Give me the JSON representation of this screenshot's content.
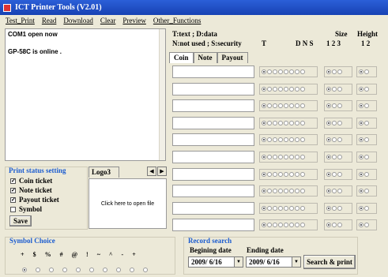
{
  "window": {
    "title": "ICT Printer Tools (V2.01)"
  },
  "menu": [
    "Test_Print",
    "Read",
    "Download",
    "Clear",
    "Preview",
    "Other_Functions"
  ],
  "log": {
    "lines": [
      "COM1  open now",
      "GP-58C is online ."
    ]
  },
  "legend": {
    "line1": "T:text ; D:data",
    "line2": "N:not used ; S:security",
    "col_T": "T",
    "col_DNS": "D N S",
    "size_label": "Size",
    "size_cols": "1  2  3",
    "height_label": "Height",
    "height_cols": "1   2"
  },
  "tabs": [
    "Coin",
    "Note",
    "Payout"
  ],
  "rows_count": 10,
  "status": {
    "title": "Print status setting",
    "items": [
      {
        "label": "Coin ticket",
        "checked": true
      },
      {
        "label": "Note ticket",
        "checked": true
      },
      {
        "label": "Payout ticket",
        "checked": true
      },
      {
        "label": "Symbol",
        "checked": false
      }
    ],
    "save_label": "Save"
  },
  "logo": {
    "tab_label": "Logo3",
    "prompt": "Click here to open file"
  },
  "symbol": {
    "title": "Symbol Choice",
    "chars": [
      "+",
      "$",
      "%",
      "#",
      "@",
      "!",
      "~",
      "^",
      "-",
      "+"
    ],
    "selected_index": 0
  },
  "record": {
    "title": "Record search",
    "begin_label": "Begining date",
    "end_label": "Ending date",
    "begin_date": "2009/ 6/16",
    "end_date": "2009/ 6/16",
    "search_label": "Search & print"
  }
}
